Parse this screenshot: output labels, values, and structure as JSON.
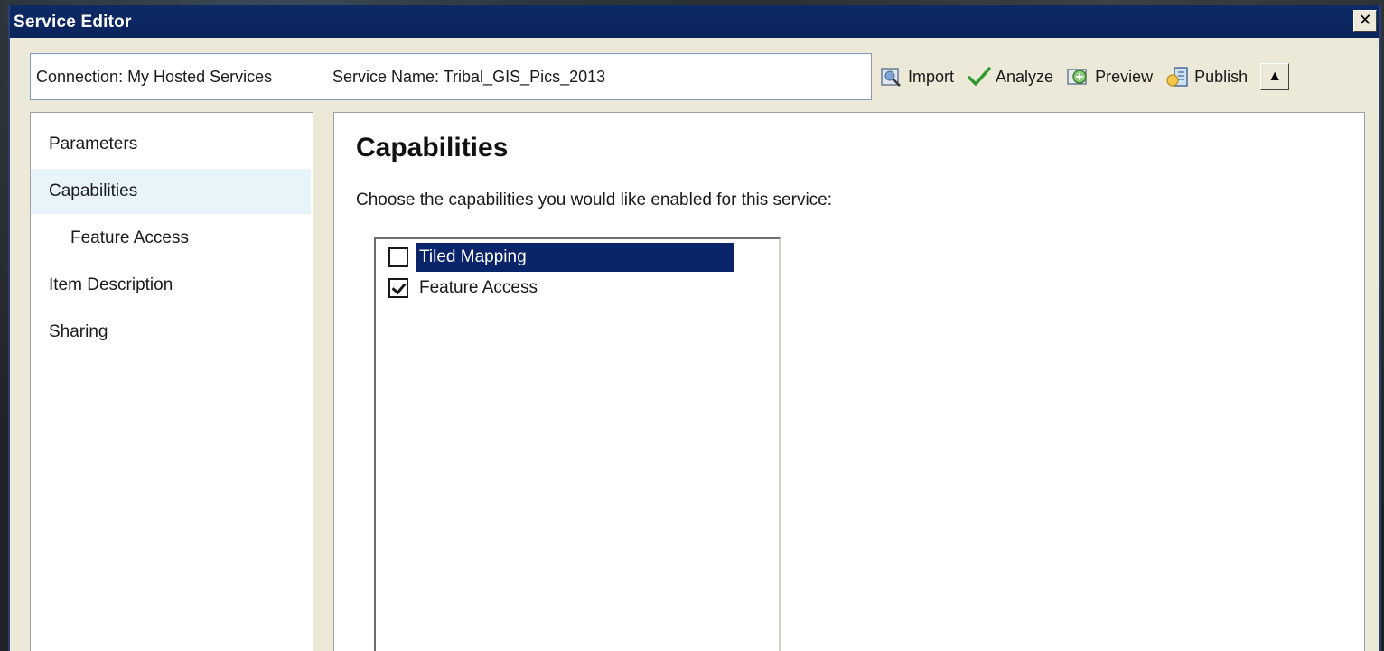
{
  "window": {
    "title": "Service Editor",
    "close_glyph": "✕"
  },
  "connection": {
    "label": "Connection: My Hosted Services",
    "service_name": "Service Name: Tribal_GIS_Pics_2013"
  },
  "toolbar": {
    "import_label": "Import",
    "analyze_label": "Analyze",
    "preview_label": "Preview",
    "publish_label": "Publish",
    "collapse_glyph": "▲"
  },
  "nav": {
    "items": [
      {
        "label": "Parameters"
      },
      {
        "label": "Capabilities"
      },
      {
        "label": "Feature Access"
      },
      {
        "label": "Item Description"
      },
      {
        "label": "Sharing"
      }
    ]
  },
  "main": {
    "heading": "Capabilities",
    "instructions": "Choose the capabilities you would like enabled for this service:",
    "capabilities": [
      {
        "label": "Tiled Mapping",
        "checked": false
      },
      {
        "label": "Feature Access",
        "checked": true
      }
    ]
  },
  "icons": {
    "import": "import-icon",
    "analyze": "checkmark-icon",
    "preview": "preview-icon",
    "publish": "publish-icon"
  },
  "colors": {
    "titlebar": "#0a245c",
    "selection": "#0a246a",
    "nav_selected": "#e7f5fb",
    "analyze_check": "#2e9a2e"
  }
}
